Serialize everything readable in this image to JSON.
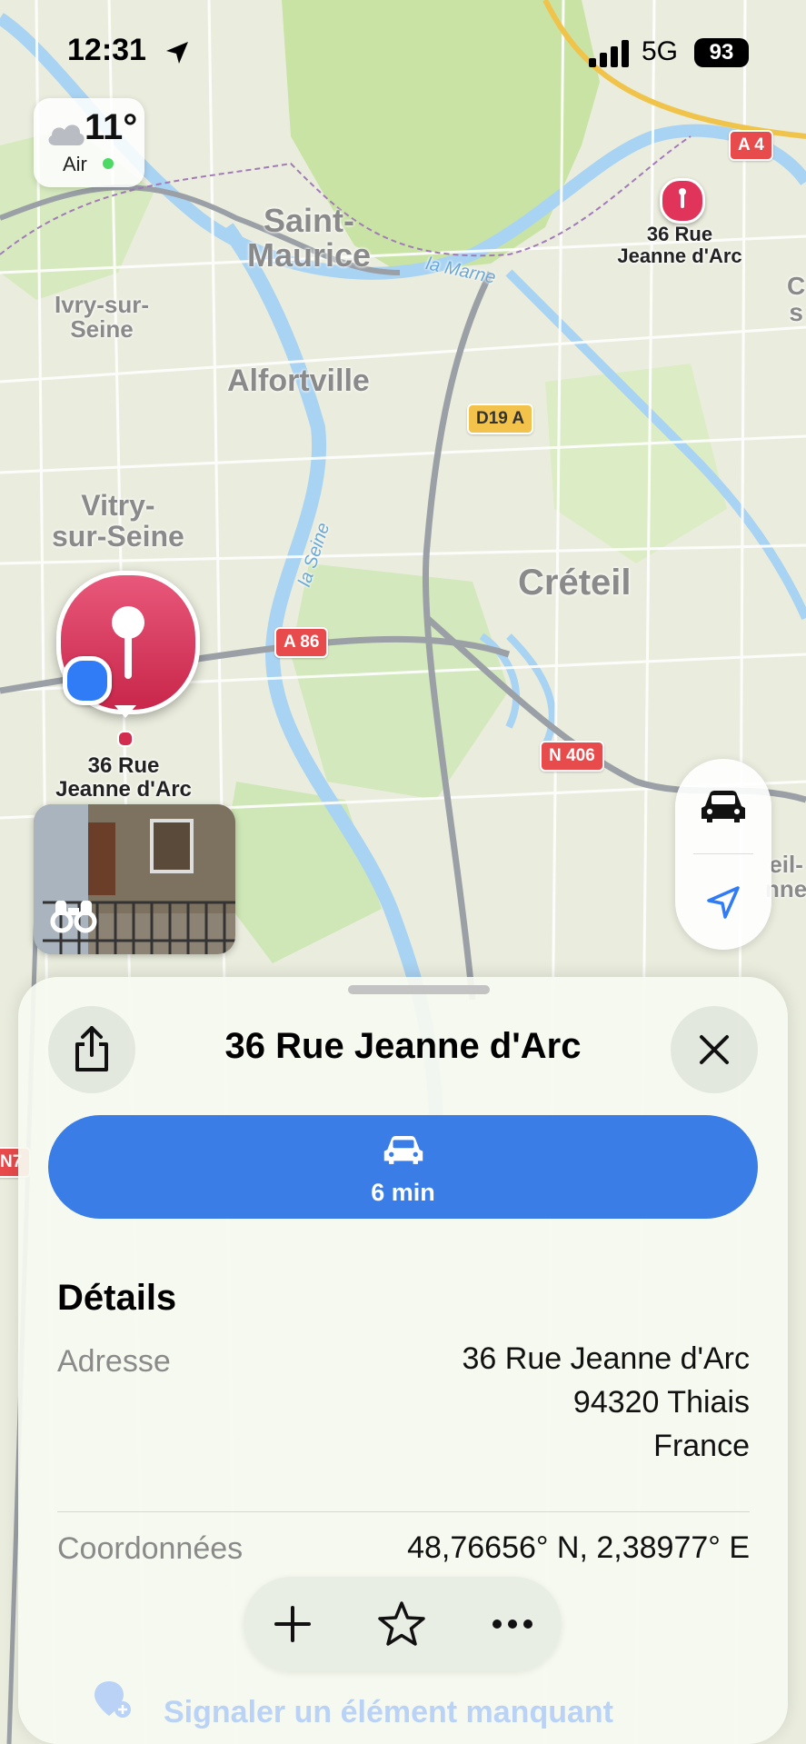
{
  "status_bar": {
    "time": "12:31",
    "network": "5G",
    "battery": "93"
  },
  "weather": {
    "temperature": "11°",
    "air_label": "Air",
    "air_color": "#4cd964",
    "icon": "cloud-icon"
  },
  "map": {
    "places": [
      {
        "name": "Saint-Maurice",
        "text": "Saint-\nMaurice"
      },
      {
        "name": "Ivry-sur-Seine",
        "text": "Ivry-sur-\nSeine"
      },
      {
        "name": "Alfortville",
        "text": "Alfortville"
      },
      {
        "name": "Vitry-sur-Seine",
        "text": "Vitry-\nsur-Seine"
      },
      {
        "name": "Créteil",
        "text": "Créteil"
      }
    ],
    "water": [
      {
        "text": "la Marne"
      },
      {
        "text": "la Seine"
      }
    ],
    "roads": [
      {
        "text": "A 4"
      },
      {
        "text": "D19 A"
      },
      {
        "text": "A 86"
      },
      {
        "text": "N 406"
      },
      {
        "text": "N7"
      }
    ],
    "pins": [
      {
        "label": "36 Rue\nJeanne d'Arc",
        "color": "#e0345a"
      },
      {
        "label": "36 Rue\nJeanne d'Arc",
        "color": "#d22c4e"
      }
    ],
    "partial_labels": [
      "C\ns",
      "eil-\nnne"
    ]
  },
  "map_controls": {
    "drive_icon": "car-icon",
    "location_icon": "location-arrow-icon"
  },
  "sheet": {
    "title": "36 Rue Jeanne d'Arc",
    "directions": {
      "mode_icon": "car-icon",
      "eta": "6 min",
      "color": "#3a7de6"
    },
    "details": {
      "heading": "Détails",
      "address_label": "Adresse",
      "address_lines": [
        "36 Rue Jeanne d'Arc",
        "94320 Thiais",
        "France"
      ],
      "coords_label": "Coordonnées",
      "coords_value": "48,76656° N, 2,38977° E"
    },
    "report_missing": "Signaler un élément manquant"
  }
}
